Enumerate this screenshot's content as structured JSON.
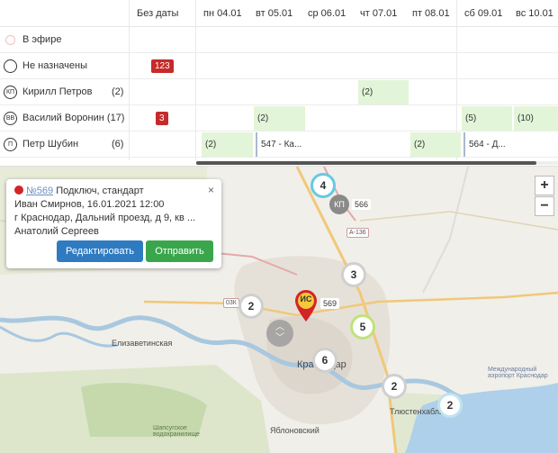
{
  "schedule": {
    "columns": [
      "Без даты",
      "пн 04.01",
      "вт 05.01",
      "ср 06.01",
      "чт 07.01",
      "пт 08.01",
      "сб 09.01",
      "вс 10.01"
    ],
    "rows": [
      {
        "icon": "",
        "name": "В эфире",
        "count": ""
      },
      {
        "icon": "",
        "name": "Не назначены",
        "count": ""
      },
      {
        "icon": "КП",
        "name": "Кирилл Петров",
        "count": "(2)"
      },
      {
        "icon": "ВВ",
        "name": "Василий Воронин (17)",
        "count": ""
      },
      {
        "icon": "П",
        "name": "Петр Шубин",
        "count": "(6)"
      }
    ],
    "badges": {
      "unassigned": "123",
      "voronin": "3"
    },
    "cells": {
      "petrov_thu": "(2)",
      "voronin_tue": "(2)",
      "voronin_sat": "(5)",
      "voronin_sun": "(10)",
      "shubin_mon": "(2)",
      "shubin_tue": "547 - Ка...",
      "shubin_fri": "(2)",
      "shubin_sat": "564 - Д..."
    }
  },
  "map": {
    "clusters": [
      "4",
      "3",
      "2",
      "5",
      "6",
      "2",
      "2"
    ],
    "pins": {
      "kp_label": "КП",
      "kp_num": "566",
      "is_label": "ИС",
      "is_num": "569"
    },
    "roads": {
      "a136": "А-136",
      "r036": "03К"
    },
    "places": {
      "elizavetinskaya": "Елизаветинская",
      "krasnodar": "Краснодар",
      "yablonovsky": "Яблоновский",
      "tlyustenkhabl": "Тлюстенхабль",
      "airport": "Международный аэропорт Краснодар",
      "reservoir": "Шапсугское водохранилище"
    },
    "zoom_in": "+",
    "zoom_out": "−"
  },
  "popup": {
    "order_number": "№569",
    "title": "Подключ, стандарт",
    "client_line": "Иван Смирнов, 16.01.2021 12:00",
    "address": "г Краснодар, Дальний проезд, д 9, кв ...",
    "worker": "Анатолий Сергеев",
    "edit_label": "Редактировать",
    "send_label": "Отправить",
    "close": "×"
  },
  "colors": {
    "accent_green": "#e2f5d8",
    "badge_red": "#c72a2a",
    "edit_blue": "#2f7bc1",
    "send_green": "#3aa64b",
    "pin_red": "#d22525"
  }
}
